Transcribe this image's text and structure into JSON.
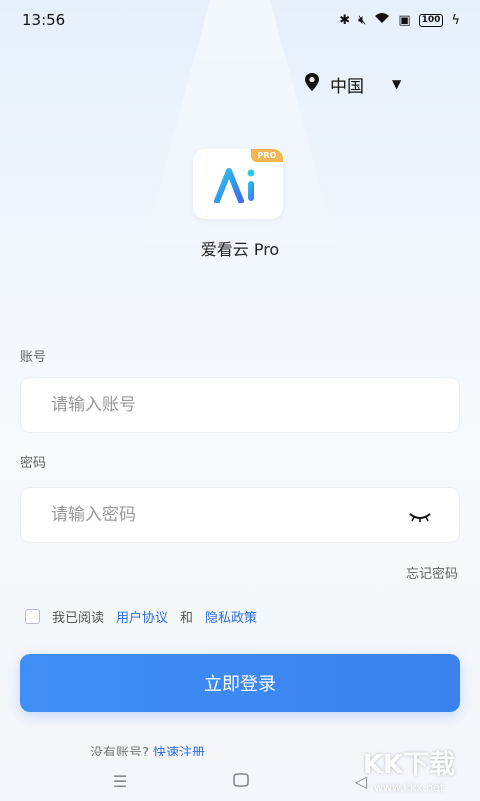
{
  "status_bar": {
    "time": "13:56",
    "battery": "100",
    "icons": [
      "bluetooth-icon",
      "mute-icon",
      "wifi-icon",
      "screen-record-icon",
      "battery-icon",
      "charging-icon"
    ]
  },
  "region": {
    "label": "中国"
  },
  "app": {
    "badge": "PRO",
    "name": "爱看云 Pro"
  },
  "account": {
    "label": "账号",
    "placeholder": "请输入账号",
    "value": ""
  },
  "password": {
    "label": "密码",
    "placeholder": "请输入密码",
    "value": ""
  },
  "forgot_password": "忘记密码",
  "agreement": {
    "prefix": "我已阅读",
    "user_agreement": "用户协议",
    "and": "和",
    "privacy_policy": "隐私政策",
    "checked": false
  },
  "login_button": "立即登录",
  "register": {
    "prompt": "没有账号?",
    "link": "快速注册"
  },
  "watermark": {
    "text": "KK下载",
    "url": "www.kkx.net"
  },
  "colors": {
    "accent": "#3b82ee",
    "link": "#2f6fe0",
    "badge": "#f3b651"
  }
}
